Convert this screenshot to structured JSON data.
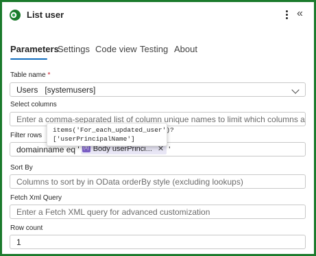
{
  "header": {
    "title": "List user",
    "more_icon": "more-vertical-icon",
    "collapse_glyph": "«",
    "logo_color": "#1b7a2c"
  },
  "tabs": [
    {
      "label": "Parameters",
      "active": true
    },
    {
      "label": "Settings"
    },
    {
      "label": "Code view"
    },
    {
      "label": "Testing"
    },
    {
      "label": "About"
    }
  ],
  "fields": {
    "table_name": {
      "label": "Table name",
      "required_mark": "*",
      "value": "Users   [systemusers]"
    },
    "select_columns": {
      "label": "Select columns",
      "placeholder": "Enter a comma-separated list of column unique names to limit which columns are listed"
    },
    "filter_rows": {
      "label": "Filter rows",
      "prefix": "domainname eq '",
      "token_label": "Body userPrinci...",
      "token_icon_text": "{x}",
      "suffix": "'",
      "tooltip_line1": "items('For_each_updated_user')?",
      "tooltip_line2": "['userPrincipalName']"
    },
    "sort_by": {
      "label": "Sort By",
      "placeholder": "Columns to sort by in OData orderBy style (excluding lookups)"
    },
    "fetch_xml": {
      "label": "Fetch Xml Query",
      "placeholder": "Enter a Fetch XML query for advanced customization"
    },
    "row_count": {
      "label": "Row count",
      "value": "1"
    }
  },
  "colors": {
    "accent": "#0f6cbd",
    "frame_border": "#1b7a2c",
    "token_bg": "#e8e6f5",
    "token_icon": "#7a5ec6"
  }
}
